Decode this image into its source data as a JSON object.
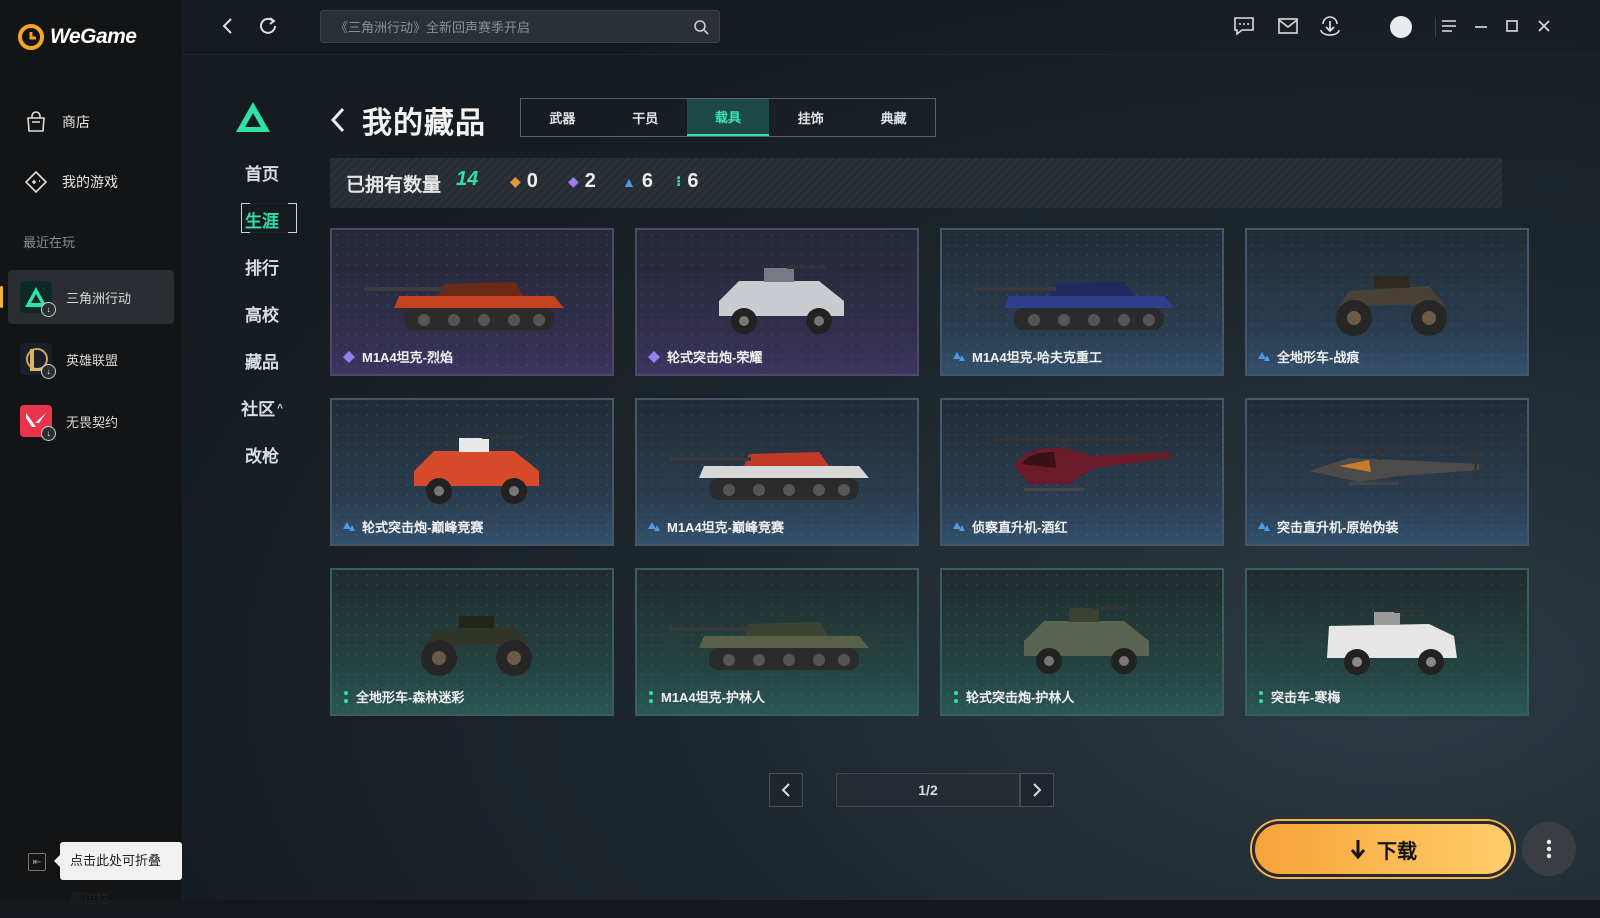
{
  "app": {
    "name": "WeGame",
    "accent": "#f5a623"
  },
  "sidebar": {
    "nav": [
      {
        "label": "商店",
        "icon": "store-icon"
      },
      {
        "label": "我的游戏",
        "icon": "gamepad-icon"
      }
    ],
    "recent_label": "最近在玩",
    "recent": [
      {
        "label": "三角洲行动",
        "icon": "delta-force-icon"
      },
      {
        "label": "英雄联盟",
        "icon": "league-of-legends-icon"
      },
      {
        "label": "无畏契约",
        "icon": "valorant-icon"
      }
    ],
    "collapse_tooltip": "点击此处可折叠侧边栏"
  },
  "topbar": {
    "search_placeholder": "《三角洲行动》全新回声赛季开启"
  },
  "game_nav": {
    "items": [
      "首页",
      "生涯",
      "排行",
      "高校",
      "藏品",
      "社区",
      "改枪"
    ],
    "active": "生涯"
  },
  "page": {
    "title": "我的藏品",
    "tabs": [
      "武器",
      "干员",
      "载具",
      "挂饰",
      "典藏"
    ],
    "active_tab": "载具",
    "stats": {
      "label": "已拥有数量",
      "total": "14",
      "rarity_counts": [
        {
          "tier": "orange",
          "color": "#e8963a",
          "count": "0"
        },
        {
          "tier": "purple",
          "color": "#9b7cf0",
          "count": "2"
        },
        {
          "tier": "blue",
          "color": "#4d9be6",
          "count": "6"
        },
        {
          "tier": "green",
          "color": "#2ee3a5",
          "count": "6"
        }
      ]
    },
    "items": [
      {
        "name": "M1A4坦克-烈焰",
        "rarity": "purple",
        "kind": "tank"
      },
      {
        "name": "轮式突击炮-荣耀",
        "rarity": "purple",
        "kind": "buggy"
      },
      {
        "name": "M1A4坦克-哈夫克重工",
        "rarity": "blue",
        "kind": "tank"
      },
      {
        "name": "全地形车-战痕",
        "rarity": "blue",
        "kind": "atv"
      },
      {
        "name": "轮式突击炮-巅峰竞赛",
        "rarity": "blue",
        "kind": "buggy"
      },
      {
        "name": "M1A4坦克-巅峰竞赛",
        "rarity": "blue",
        "kind": "tank"
      },
      {
        "name": "侦察直升机-酒红",
        "rarity": "blue",
        "kind": "heli"
      },
      {
        "name": "突击直升机-原始伪装",
        "rarity": "blue",
        "kind": "attack-heli"
      },
      {
        "name": "全地形车-森林迷彩",
        "rarity": "green",
        "kind": "atv"
      },
      {
        "name": "M1A4坦克-护林人",
        "rarity": "green",
        "kind": "tank"
      },
      {
        "name": "轮式突击炮-护林人",
        "rarity": "green",
        "kind": "buggy"
      },
      {
        "name": "突击车-寒梅",
        "rarity": "green",
        "kind": "truck"
      }
    ],
    "pager": "1/2"
  },
  "actions": {
    "download": "下载"
  }
}
